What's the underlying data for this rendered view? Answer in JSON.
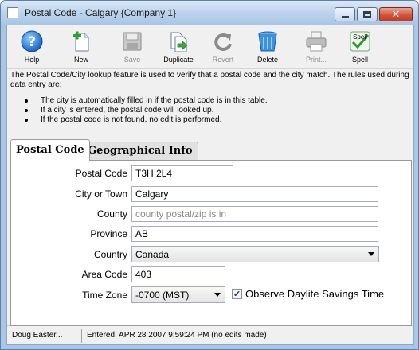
{
  "window": {
    "title": "Postal Code - Calgary {Company 1}"
  },
  "toolbar": {
    "buttons": [
      {
        "label": "Help",
        "icon": "help-icon",
        "enabled": true
      },
      {
        "label": "New",
        "icon": "new-document-icon",
        "enabled": true
      },
      {
        "label": "Save",
        "icon": "save-disk-icon",
        "enabled": false
      },
      {
        "label": "Duplicate",
        "icon": "duplicate-icon",
        "enabled": true
      },
      {
        "label": "Revert",
        "icon": "revert-icon",
        "enabled": false
      },
      {
        "label": "Delete",
        "icon": "delete-bin-icon",
        "enabled": true
      },
      {
        "label": "Print...",
        "icon": "printer-icon",
        "enabled": false
      },
      {
        "label": "Spell",
        "icon": "spell-check-icon",
        "enabled": true,
        "icon_text": "Spell"
      }
    ]
  },
  "info": {
    "text": "The Postal Code/City lookup feature is used to verify that a postal code and the city match.  The rules used during data entry are:",
    "bullets": [
      "The city is automatically filled in if the postal code is in this table.",
      "If a city is entered, the postal code will looked up.",
      "If the postal code is not found, no edit is performed."
    ]
  },
  "tabs": [
    {
      "label": "Postal Code",
      "active": true
    },
    {
      "label": "Geographical Info",
      "active": false
    }
  ],
  "form": {
    "postal_code": {
      "label": "Postal Code",
      "value": "T3H 2L4"
    },
    "city": {
      "label": "City or Town",
      "value": "Calgary"
    },
    "county": {
      "label": "County",
      "value": "",
      "placeholder": "county postal/zip is in"
    },
    "province": {
      "label": "Province",
      "value": "AB"
    },
    "country": {
      "label": "Country",
      "value": "Canada"
    },
    "area_code": {
      "label": "Area Code",
      "value": "403"
    },
    "time_zone": {
      "label": "Time Zone",
      "value": "-0700 (MST)"
    },
    "dst": {
      "label": "Observe Daylite Savings Time",
      "checked": true
    }
  },
  "status": {
    "user": "Doug Easter...",
    "entered": "Entered: APR 28 2007  9:59:24 PM (no edits made)"
  },
  "colors": {
    "title_bar": "#a9c6e4",
    "close_button": "#d4553b",
    "accent_blue": "#1f6fd0"
  }
}
